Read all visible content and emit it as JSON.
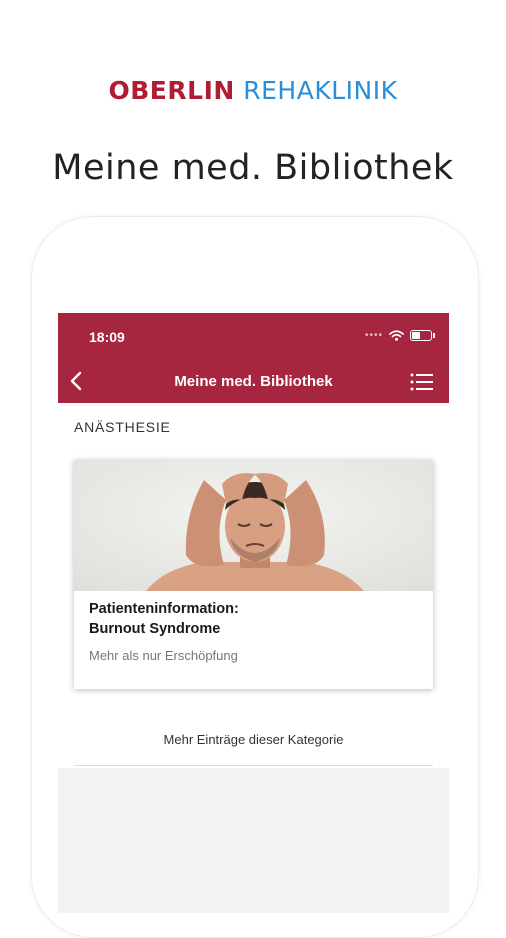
{
  "header": {
    "brand_part1": "OBERLIN",
    "brand_part2": "REHAKLINIK",
    "headline": "Meine med. Bibliothek"
  },
  "status_bar": {
    "time": "18:09",
    "icons": [
      "signal-dots-icon",
      "wifi-icon",
      "battery-icon"
    ]
  },
  "app_bar": {
    "title": "Meine med. Bibliothek",
    "back_icon": "chevron-left-icon",
    "menu_icon": "list-menu-icon"
  },
  "content": {
    "category": "ANÄSTHESIE",
    "card": {
      "title_line1": "Patienteninformation:",
      "title_line2": "Burnout Syndrome",
      "subtitle": "Mehr als nur Erschöpfung"
    },
    "more_link": "Mehr Einträge dieser Kategorie"
  },
  "colors": {
    "brand_red": "#b01c33",
    "brand_blue": "#2a8fd6",
    "app_bar": "#a5263e",
    "background": "#f2f2f4"
  }
}
